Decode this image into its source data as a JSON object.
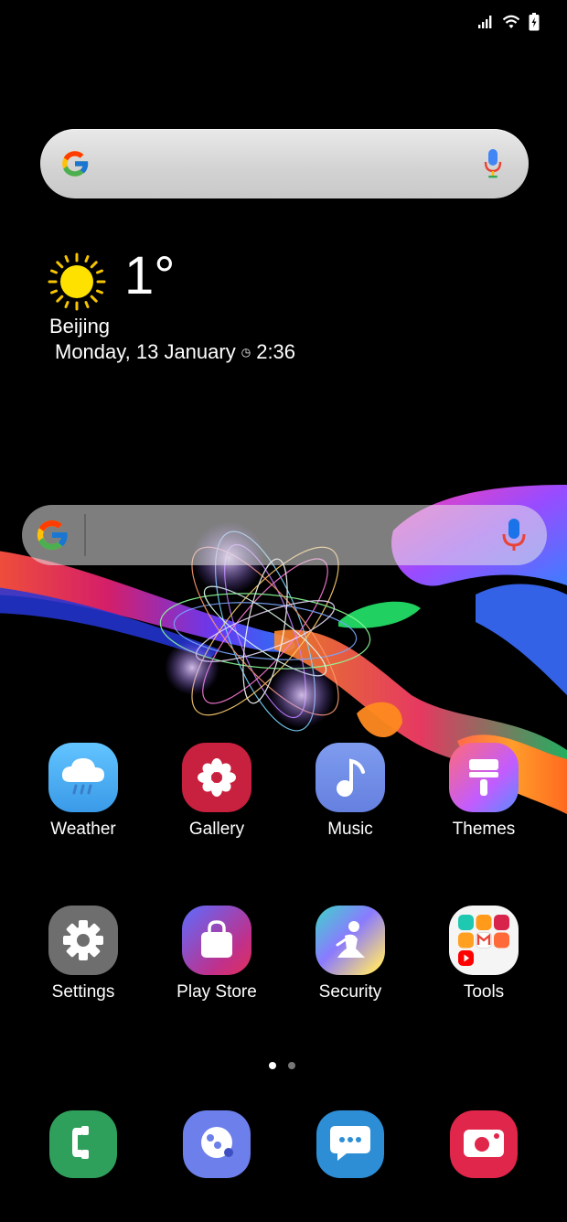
{
  "status_bar": {
    "icons": [
      "signal-icon",
      "wifi-icon",
      "battery-charging-icon"
    ]
  },
  "top_search": {
    "logo": "google-g-icon",
    "mic": "microphone-icon"
  },
  "weather_widget": {
    "temperature": "1°",
    "city": "Beijing",
    "date": "Monday, 13 January",
    "time": "2:36",
    "icon": "sun-icon"
  },
  "mid_search": {
    "logo": "google-g-icon",
    "mic": "microphone-icon"
  },
  "apps_row1": [
    {
      "label": "Weather",
      "icon": "weather-cloud-rain-icon"
    },
    {
      "label": "Gallery",
      "icon": "gallery-flower-icon"
    },
    {
      "label": "Music",
      "icon": "music-note-icon"
    },
    {
      "label": "Themes",
      "icon": "themes-brush-icon"
    }
  ],
  "apps_row2": [
    {
      "label": "Settings",
      "icon": "gear-icon"
    },
    {
      "label": "Play Store",
      "icon": "shopping-bag-icon"
    },
    {
      "label": "Security",
      "icon": "security-figure-icon"
    },
    {
      "label": "Tools",
      "icon": "folder-grid-icon"
    }
  ],
  "page_indicator": {
    "pages": 2,
    "current": 1
  },
  "dock": [
    {
      "icon": "phone-icon"
    },
    {
      "icon": "contacts-dots-icon"
    },
    {
      "icon": "messages-icon"
    },
    {
      "icon": "camera-icon"
    }
  ],
  "colors": {
    "background": "#000000",
    "weather": "#4ab1f0",
    "gallery": "#c8203f",
    "music": "#6f8fe4",
    "settings": "#6e6e6e",
    "phone": "#2f9f5c",
    "contacts": "#6c7fea",
    "messages": "#2d8ed6",
    "camera": "#e0264a"
  }
}
